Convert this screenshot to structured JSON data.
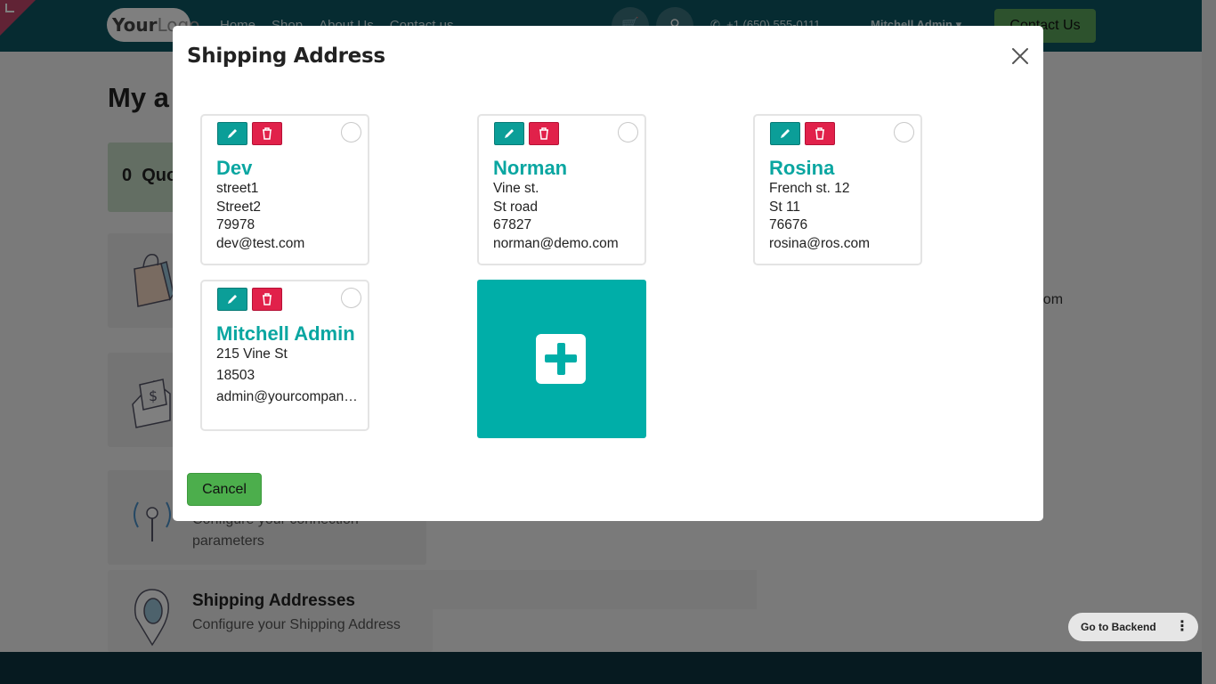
{
  "nav": {
    "logo_a": "Your",
    "logo_b": "Logo",
    "links": [
      "Home",
      "Shop",
      "About Us",
      "Contact us"
    ],
    "phone": "+1 (650) 555-0111",
    "user": "Mitchell Admin",
    "contact_label": "Contact Us"
  },
  "page": {
    "title": "My a",
    "quotes_count": "0",
    "quotes_label": "Quo",
    "connection_sub": "Configure your connection parameters",
    "shipping_title": "Shipping Addresses",
    "shipping_sub": "Configure your Shipping Address",
    "email_fragment": "ple.com"
  },
  "backend": {
    "label": "Go to Backend"
  },
  "modal": {
    "title": "Shipping Address",
    "cancel_label": "Cancel",
    "addresses": [
      {
        "name": "Dev",
        "lines": [
          "street1",
          "Street2",
          "79978",
          "dev@test.com"
        ]
      },
      {
        "name": "Norman",
        "lines": [
          "Vine st.",
          "St road",
          "67827",
          "norman@demo.com"
        ]
      },
      {
        "name": "Rosina",
        "lines": [
          "French st. 12",
          "St 11",
          "76676",
          "rosina@ros.com"
        ]
      },
      {
        "name": "Mitchell Admin",
        "lines": [
          "215 Vine St",
          "18503",
          "admin@yourcompany.example.com"
        ]
      }
    ]
  },
  "colors": {
    "primary": "#00aea8",
    "danger": "#e1214a",
    "success": "#4cae4c",
    "header": "#0d5662"
  },
  "icons": {
    "edit": "pencil-icon",
    "delete": "trash-icon",
    "add": "plus-square-icon",
    "close": "close-icon"
  }
}
